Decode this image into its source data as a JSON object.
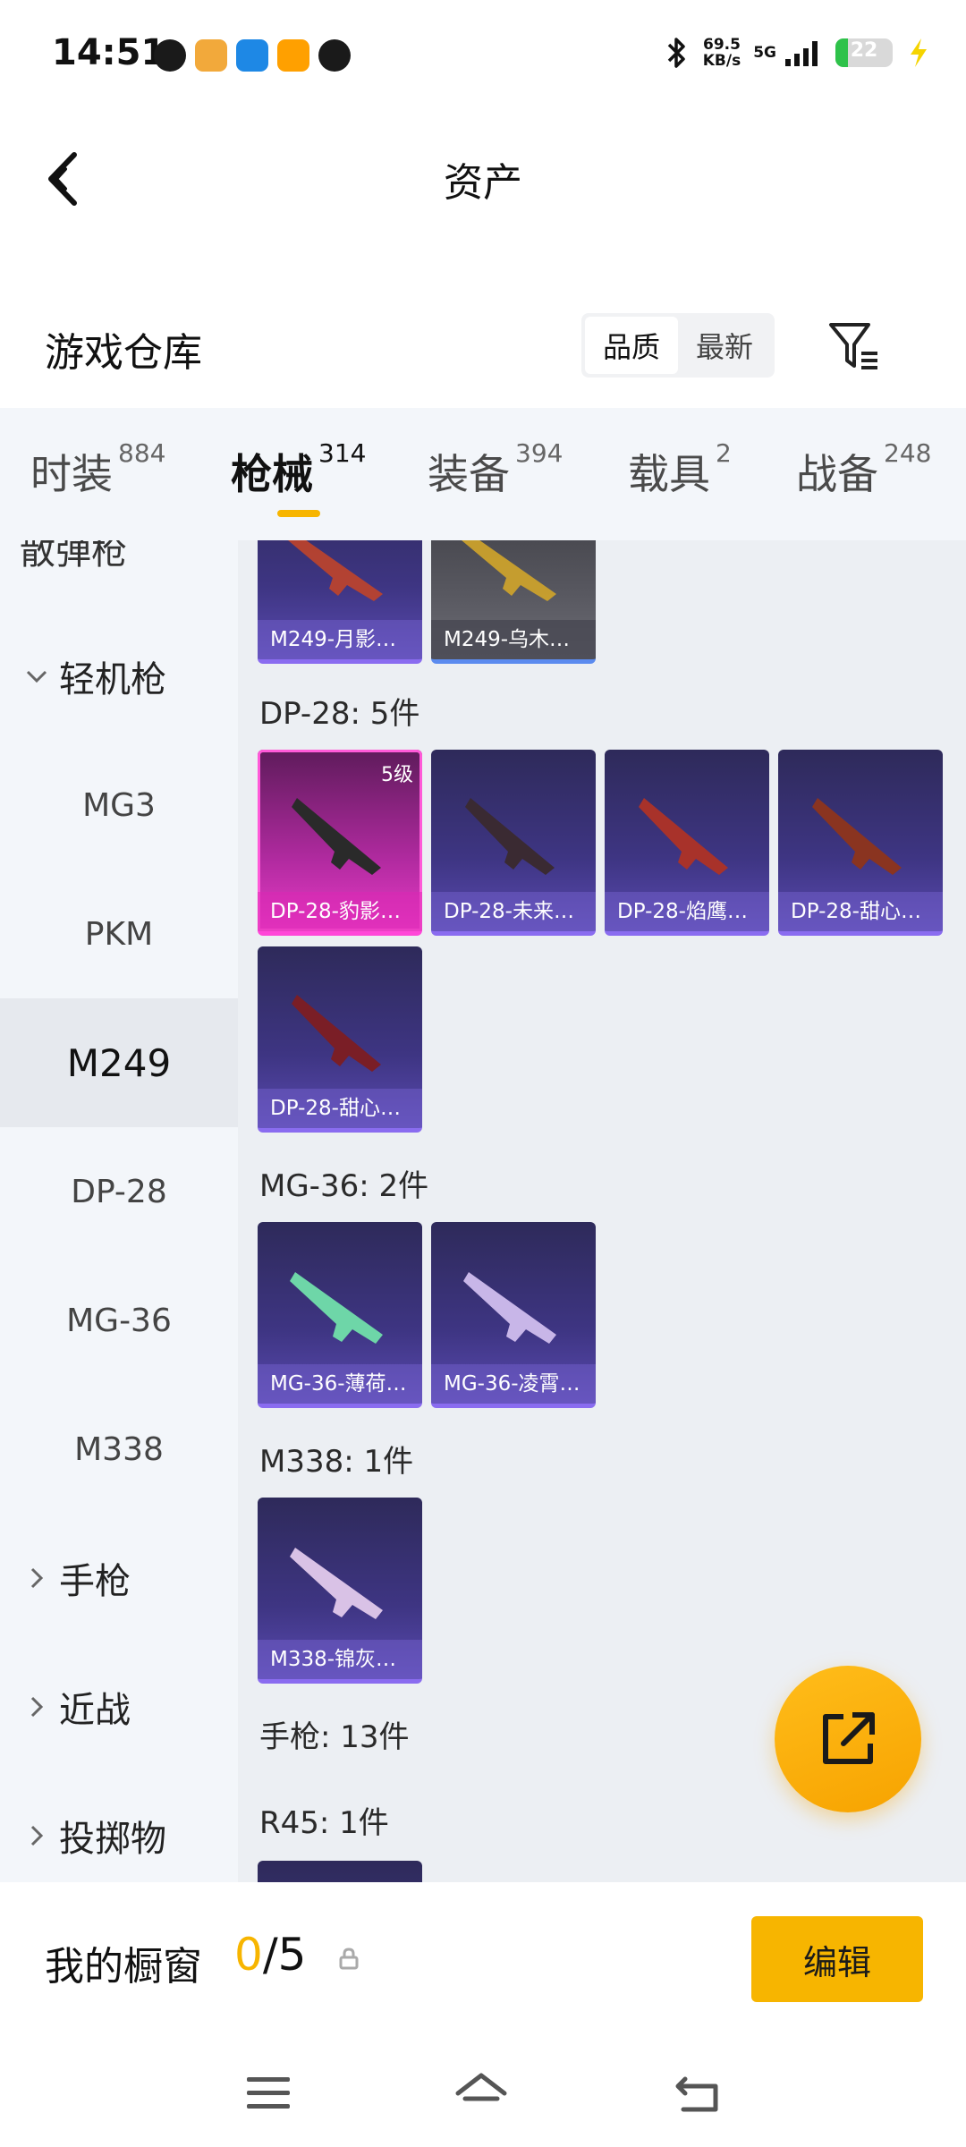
{
  "status_bar": {
    "time": "14:51",
    "net_speed_value": "69.5",
    "net_speed_unit": "KB/s",
    "network_type": "5G",
    "battery": "22",
    "battery_level": 0.22,
    "app_icon_colors": [
      "#1a1a1a",
      "#f2a93b",
      "#1e88e5",
      "#ffa000",
      "#1a1a1a"
    ]
  },
  "title_bar": {
    "title": "资产",
    "back_icon": "chevron-left-icon"
  },
  "warehouse": {
    "title": "游戏仓库",
    "sort_options": [
      "品质",
      "最新"
    ],
    "sort_selected": "品质",
    "filter_icon": "filter-icon"
  },
  "tabs": [
    {
      "label": "时装",
      "count": "884"
    },
    {
      "label": "枪械",
      "count": "314",
      "active": true
    },
    {
      "label": "装备",
      "count": "394"
    },
    {
      "label": "载具",
      "count": "2"
    },
    {
      "label": "战备",
      "count": "248"
    }
  ],
  "sidebar": {
    "partial_top": "散弹枪",
    "items": [
      {
        "label": "轻机枪",
        "type": "category",
        "expanded": true
      },
      {
        "label": "MG3",
        "type": "sub"
      },
      {
        "label": "PKM",
        "type": "sub"
      },
      {
        "label": "M249",
        "type": "sub",
        "selected": true
      },
      {
        "label": "DP-28",
        "type": "sub"
      },
      {
        "label": "MG-36",
        "type": "sub"
      },
      {
        "label": "M338",
        "type": "sub"
      },
      {
        "label": "手枪",
        "type": "category"
      },
      {
        "label": "近战",
        "type": "category"
      },
      {
        "label": "投掷物",
        "type": "category"
      }
    ]
  },
  "content": {
    "groups": [
      {
        "label": "",
        "cards": [
          {
            "name": "M249-月影…",
            "style": "purple"
          },
          {
            "name": "M249-乌木…",
            "style": "grey"
          }
        ]
      },
      {
        "label": "DP-28: 5件",
        "cards": [
          {
            "name": "DP-28-豹影…",
            "style": "pink",
            "level": "5级"
          },
          {
            "name": "DP-28-未来…",
            "style": "purple"
          },
          {
            "name": "DP-28-焰鹰…",
            "style": "purple"
          },
          {
            "name": "DP-28-甜心…",
            "style": "purple"
          },
          {
            "name": "DP-28-甜心…",
            "style": "purple"
          }
        ]
      },
      {
        "label": "MG-36: 2件",
        "cards": [
          {
            "name": "MG-36-薄荷…",
            "style": "purple"
          },
          {
            "name": "MG-36-凌霄…",
            "style": "purple"
          }
        ]
      },
      {
        "label": "M338: 1件",
        "cards": [
          {
            "name": "M338-锦灰…",
            "style": "purple"
          }
        ]
      },
      {
        "label": "手枪: 13件",
        "cards": []
      },
      {
        "label": "R45: 1件",
        "cards": []
      }
    ]
  },
  "fab": {
    "icon": "share-external-icon"
  },
  "showcase": {
    "title": "我的橱窗",
    "current": "0",
    "total": "/5",
    "edit_label": "编辑"
  },
  "navbar": {
    "icons": [
      "menu-icon",
      "home-icon",
      "back-icon"
    ]
  }
}
